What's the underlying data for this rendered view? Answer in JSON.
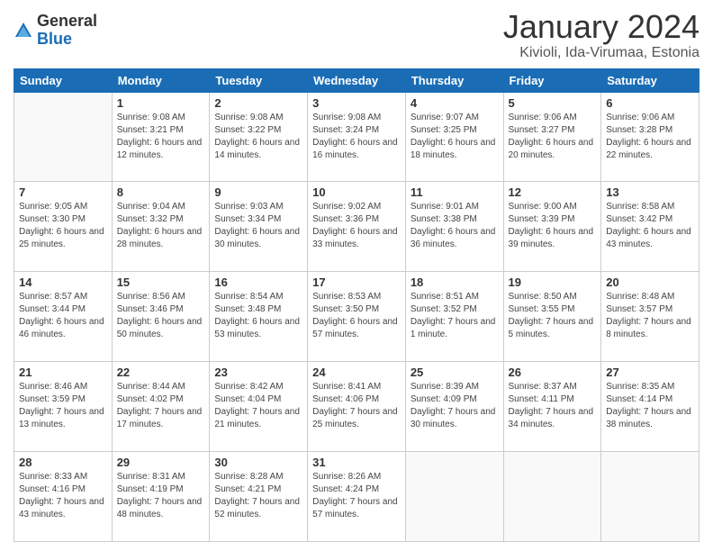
{
  "logo": {
    "general": "General",
    "blue": "Blue"
  },
  "header": {
    "title": "January 2024",
    "subtitle": "Kivioli, Ida-Virumaa, Estonia"
  },
  "weekdays": [
    "Sunday",
    "Monday",
    "Tuesday",
    "Wednesday",
    "Thursday",
    "Friday",
    "Saturday"
  ],
  "weeks": [
    [
      {
        "day": "",
        "sunrise": "",
        "sunset": "",
        "daylight": ""
      },
      {
        "day": "1",
        "sunrise": "Sunrise: 9:08 AM",
        "sunset": "Sunset: 3:21 PM",
        "daylight": "Daylight: 6 hours and 12 minutes."
      },
      {
        "day": "2",
        "sunrise": "Sunrise: 9:08 AM",
        "sunset": "Sunset: 3:22 PM",
        "daylight": "Daylight: 6 hours and 14 minutes."
      },
      {
        "day": "3",
        "sunrise": "Sunrise: 9:08 AM",
        "sunset": "Sunset: 3:24 PM",
        "daylight": "Daylight: 6 hours and 16 minutes."
      },
      {
        "day": "4",
        "sunrise": "Sunrise: 9:07 AM",
        "sunset": "Sunset: 3:25 PM",
        "daylight": "Daylight: 6 hours and 18 minutes."
      },
      {
        "day": "5",
        "sunrise": "Sunrise: 9:06 AM",
        "sunset": "Sunset: 3:27 PM",
        "daylight": "Daylight: 6 hours and 20 minutes."
      },
      {
        "day": "6",
        "sunrise": "Sunrise: 9:06 AM",
        "sunset": "Sunset: 3:28 PM",
        "daylight": "Daylight: 6 hours and 22 minutes."
      }
    ],
    [
      {
        "day": "7",
        "sunrise": "Sunrise: 9:05 AM",
        "sunset": "Sunset: 3:30 PM",
        "daylight": "Daylight: 6 hours and 25 minutes."
      },
      {
        "day": "8",
        "sunrise": "Sunrise: 9:04 AM",
        "sunset": "Sunset: 3:32 PM",
        "daylight": "Daylight: 6 hours and 28 minutes."
      },
      {
        "day": "9",
        "sunrise": "Sunrise: 9:03 AM",
        "sunset": "Sunset: 3:34 PM",
        "daylight": "Daylight: 6 hours and 30 minutes."
      },
      {
        "day": "10",
        "sunrise": "Sunrise: 9:02 AM",
        "sunset": "Sunset: 3:36 PM",
        "daylight": "Daylight: 6 hours and 33 minutes."
      },
      {
        "day": "11",
        "sunrise": "Sunrise: 9:01 AM",
        "sunset": "Sunset: 3:38 PM",
        "daylight": "Daylight: 6 hours and 36 minutes."
      },
      {
        "day": "12",
        "sunrise": "Sunrise: 9:00 AM",
        "sunset": "Sunset: 3:39 PM",
        "daylight": "Daylight: 6 hours and 39 minutes."
      },
      {
        "day": "13",
        "sunrise": "Sunrise: 8:58 AM",
        "sunset": "Sunset: 3:42 PM",
        "daylight": "Daylight: 6 hours and 43 minutes."
      }
    ],
    [
      {
        "day": "14",
        "sunrise": "Sunrise: 8:57 AM",
        "sunset": "Sunset: 3:44 PM",
        "daylight": "Daylight: 6 hours and 46 minutes."
      },
      {
        "day": "15",
        "sunrise": "Sunrise: 8:56 AM",
        "sunset": "Sunset: 3:46 PM",
        "daylight": "Daylight: 6 hours and 50 minutes."
      },
      {
        "day": "16",
        "sunrise": "Sunrise: 8:54 AM",
        "sunset": "Sunset: 3:48 PM",
        "daylight": "Daylight: 6 hours and 53 minutes."
      },
      {
        "day": "17",
        "sunrise": "Sunrise: 8:53 AM",
        "sunset": "Sunset: 3:50 PM",
        "daylight": "Daylight: 6 hours and 57 minutes."
      },
      {
        "day": "18",
        "sunrise": "Sunrise: 8:51 AM",
        "sunset": "Sunset: 3:52 PM",
        "daylight": "Daylight: 7 hours and 1 minute."
      },
      {
        "day": "19",
        "sunrise": "Sunrise: 8:50 AM",
        "sunset": "Sunset: 3:55 PM",
        "daylight": "Daylight: 7 hours and 5 minutes."
      },
      {
        "day": "20",
        "sunrise": "Sunrise: 8:48 AM",
        "sunset": "Sunset: 3:57 PM",
        "daylight": "Daylight: 7 hours and 8 minutes."
      }
    ],
    [
      {
        "day": "21",
        "sunrise": "Sunrise: 8:46 AM",
        "sunset": "Sunset: 3:59 PM",
        "daylight": "Daylight: 7 hours and 13 minutes."
      },
      {
        "day": "22",
        "sunrise": "Sunrise: 8:44 AM",
        "sunset": "Sunset: 4:02 PM",
        "daylight": "Daylight: 7 hours and 17 minutes."
      },
      {
        "day": "23",
        "sunrise": "Sunrise: 8:42 AM",
        "sunset": "Sunset: 4:04 PM",
        "daylight": "Daylight: 7 hours and 21 minutes."
      },
      {
        "day": "24",
        "sunrise": "Sunrise: 8:41 AM",
        "sunset": "Sunset: 4:06 PM",
        "daylight": "Daylight: 7 hours and 25 minutes."
      },
      {
        "day": "25",
        "sunrise": "Sunrise: 8:39 AM",
        "sunset": "Sunset: 4:09 PM",
        "daylight": "Daylight: 7 hours and 30 minutes."
      },
      {
        "day": "26",
        "sunrise": "Sunrise: 8:37 AM",
        "sunset": "Sunset: 4:11 PM",
        "daylight": "Daylight: 7 hours and 34 minutes."
      },
      {
        "day": "27",
        "sunrise": "Sunrise: 8:35 AM",
        "sunset": "Sunset: 4:14 PM",
        "daylight": "Daylight: 7 hours and 38 minutes."
      }
    ],
    [
      {
        "day": "28",
        "sunrise": "Sunrise: 8:33 AM",
        "sunset": "Sunset: 4:16 PM",
        "daylight": "Daylight: 7 hours and 43 minutes."
      },
      {
        "day": "29",
        "sunrise": "Sunrise: 8:31 AM",
        "sunset": "Sunset: 4:19 PM",
        "daylight": "Daylight: 7 hours and 48 minutes."
      },
      {
        "day": "30",
        "sunrise": "Sunrise: 8:28 AM",
        "sunset": "Sunset: 4:21 PM",
        "daylight": "Daylight: 7 hours and 52 minutes."
      },
      {
        "day": "31",
        "sunrise": "Sunrise: 8:26 AM",
        "sunset": "Sunset: 4:24 PM",
        "daylight": "Daylight: 7 hours and 57 minutes."
      },
      {
        "day": "",
        "sunrise": "",
        "sunset": "",
        "daylight": ""
      },
      {
        "day": "",
        "sunrise": "",
        "sunset": "",
        "daylight": ""
      },
      {
        "day": "",
        "sunrise": "",
        "sunset": "",
        "daylight": ""
      }
    ]
  ]
}
